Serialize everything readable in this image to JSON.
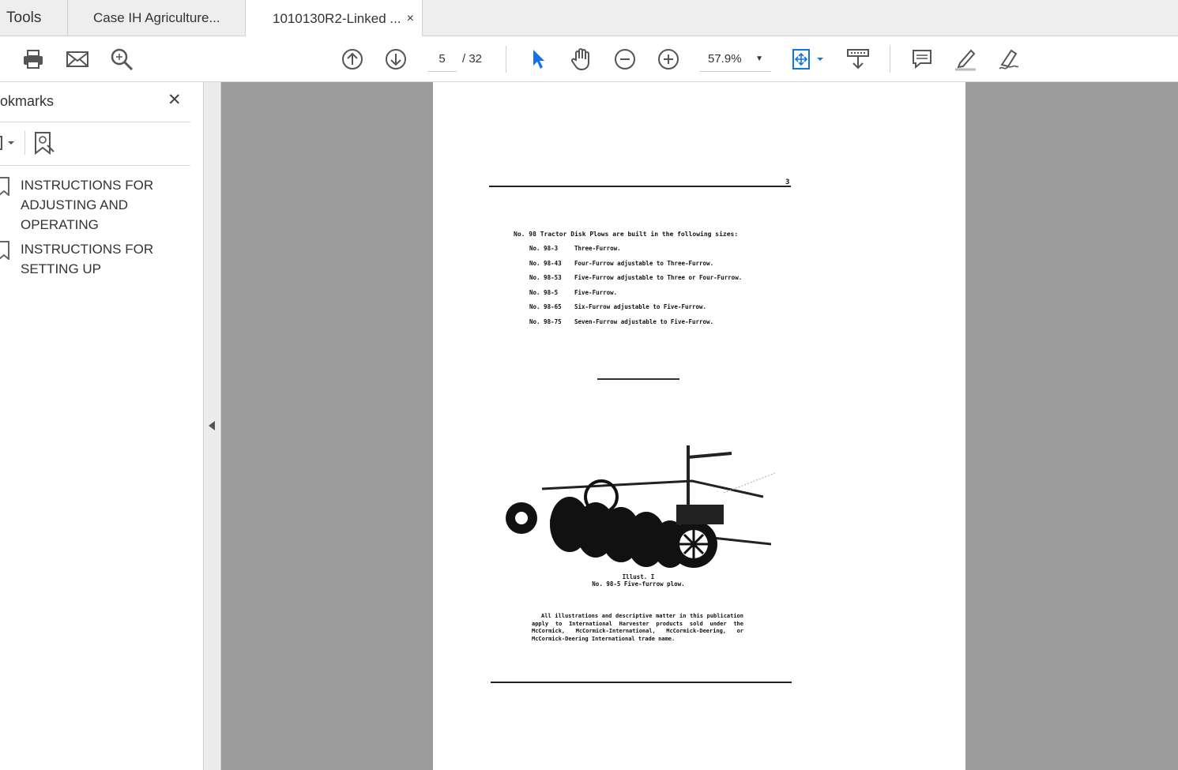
{
  "tabs": [
    {
      "label": "Tools"
    },
    {
      "label": "Case IH Agriculture..."
    },
    {
      "label": "1010130R2-Linked ...",
      "close": "×"
    }
  ],
  "toolbar": {
    "page_current": "5",
    "page_total": "/ 32",
    "zoom": "57.9%"
  },
  "sidebar": {
    "title": "okmarks",
    "close": "✕",
    "bookmarks": [
      {
        "label": "INSTRUCTIONS FOR ADJUSTING AND OPERATING"
      },
      {
        "label": "INSTRUCTIONS FOR SETTING UP"
      }
    ]
  },
  "document": {
    "page_number": "3",
    "intro": "No. 98 Tractor Disk Plows are built in the following sizes:",
    "sizes": [
      {
        "no": "No. 98-3",
        "desc": "Three-Furrow."
      },
      {
        "no": "No. 98-43",
        "desc": "Four-Furrow adjustable to Three-Furrow."
      },
      {
        "no": "No. 98-53",
        "desc": "Five-Furrow adjustable to Three or Four-Furrow."
      },
      {
        "no": "No. 98-5",
        "desc": "Five-Furrow."
      },
      {
        "no": "No. 98-65",
        "desc": "Six-Furrow adjustable to Five-Furrow."
      },
      {
        "no": "No. 98-75",
        "desc": "Seven-Furrow adjustable to Five-Furrow."
      }
    ],
    "caption1": "Illust. I",
    "caption2": "No. 98-5 Five-furrow plow.",
    "notice": "All illustrations and descriptive matter in this publication apply to International Harvester products sold under the McCormick, McCormick-International, McCormick-Deering, or McCormick-Deering International trade name."
  }
}
